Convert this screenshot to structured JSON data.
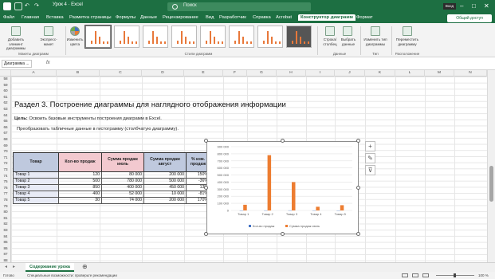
{
  "window": {
    "title": "Урок 4 · Excel",
    "search_placeholder": "Поиск",
    "user": "Вход",
    "minimize": "–",
    "maximize": "□",
    "close": "✕"
  },
  "tabs": [
    "Файл",
    "Главная",
    "Вставка",
    "Разметка страницы",
    "Формулы",
    "Данные",
    "Рецензирование",
    "Вид",
    "Разработчик",
    "Справка",
    "Acrobat",
    "Конструктор диаграмм",
    "Формат"
  ],
  "active_tab": "Конструктор диаграмм",
  "share_label": "Общий доступ",
  "ribbon": {
    "add_element": "Добавить элемент диаграммы",
    "quick_layout": "Экспресс-макет",
    "change_colors": "Изменить цвета",
    "switch_rowcol": "Строка/столбец",
    "select_data": "Выбрать данные",
    "change_type": "Изменить тип диаграммы",
    "move_chart": "Переместить диаграмму",
    "groups": {
      "layouts": "Макеты диаграмм",
      "styles": "Стили диаграмм",
      "data": "Данные",
      "type": "Тип",
      "location": "Расположение"
    }
  },
  "formula_bar": {
    "name_box": "Диаграмма ...",
    "fx": "fx"
  },
  "columns": [
    "A",
    "B",
    "C",
    "D",
    "E",
    "F",
    "G",
    "H",
    "I",
    "J",
    "K",
    "L",
    "M",
    "N"
  ],
  "rows": [
    "58",
    "59",
    "60",
    "61",
    "62",
    "63",
    "64",
    "65",
    "66",
    "67",
    "68",
    "69",
    "70",
    "71",
    "72",
    "73",
    "74",
    "75",
    "76",
    "77",
    "78",
    "79",
    "80",
    "81",
    "82",
    "83",
    "84",
    "85",
    "86",
    "87",
    "88"
  ],
  "content": {
    "section_title": "Раздел 3. Построение диаграммы для наглядного отображения информации",
    "goal_label": "Цель:",
    "goal_text": " Освоить базовые инструменты построения диаграмм в Excel.",
    "task": "Преобразовать табличные данные в гистограмму (столбчатую диаграмму)."
  },
  "table": {
    "headers": [
      "Товар",
      "Кол-во продаж",
      "Сумма продаж июль",
      "Сумма продаж август",
      "% изм. продаж"
    ],
    "rows": [
      [
        "Товар 1",
        "120",
        "80 000",
        "200 000",
        "150%"
      ],
      [
        "Товар 2",
        "500",
        "780 000",
        "500 000",
        "-36%"
      ],
      [
        "Товар 3",
        "850",
        "400 000",
        "450 000",
        "13%"
      ],
      [
        "Товар 4",
        "400",
        "52 000",
        "10 000",
        "-81%"
      ],
      [
        "Товар 5",
        "30",
        "74 000",
        "200 000",
        "170%"
      ]
    ]
  },
  "chart_data": {
    "type": "bar",
    "categories": [
      "Товар 1",
      "Товар 2",
      "Товар 3",
      "Товар 4",
      "Товар 5"
    ],
    "series": [
      {
        "name": "Кол-во продаж",
        "values": [
          120,
          500,
          850,
          400,
          30
        ],
        "color": "#4472c4"
      },
      {
        "name": "Сумма продаж июль",
        "values": [
          80000,
          780000,
          400000,
          52000,
          74000
        ],
        "color": "#ed7d31"
      }
    ],
    "yticks": [
      "900 000",
      "800 000",
      "700 000",
      "600 000",
      "500 000",
      "400 000",
      "300 000",
      "200 000",
      "100 000",
      "0"
    ],
    "ylim": [
      0,
      900000
    ],
    "legend": "bottom",
    "grid": true
  },
  "chart_tools": [
    "+",
    "✎",
    "⊽"
  ],
  "sheet_tab": "Содержание урока",
  "status": {
    "left": "Готово",
    "accessibility": "Специальные возможности: проверьте рекомендации",
    "zoom": "100 %"
  }
}
